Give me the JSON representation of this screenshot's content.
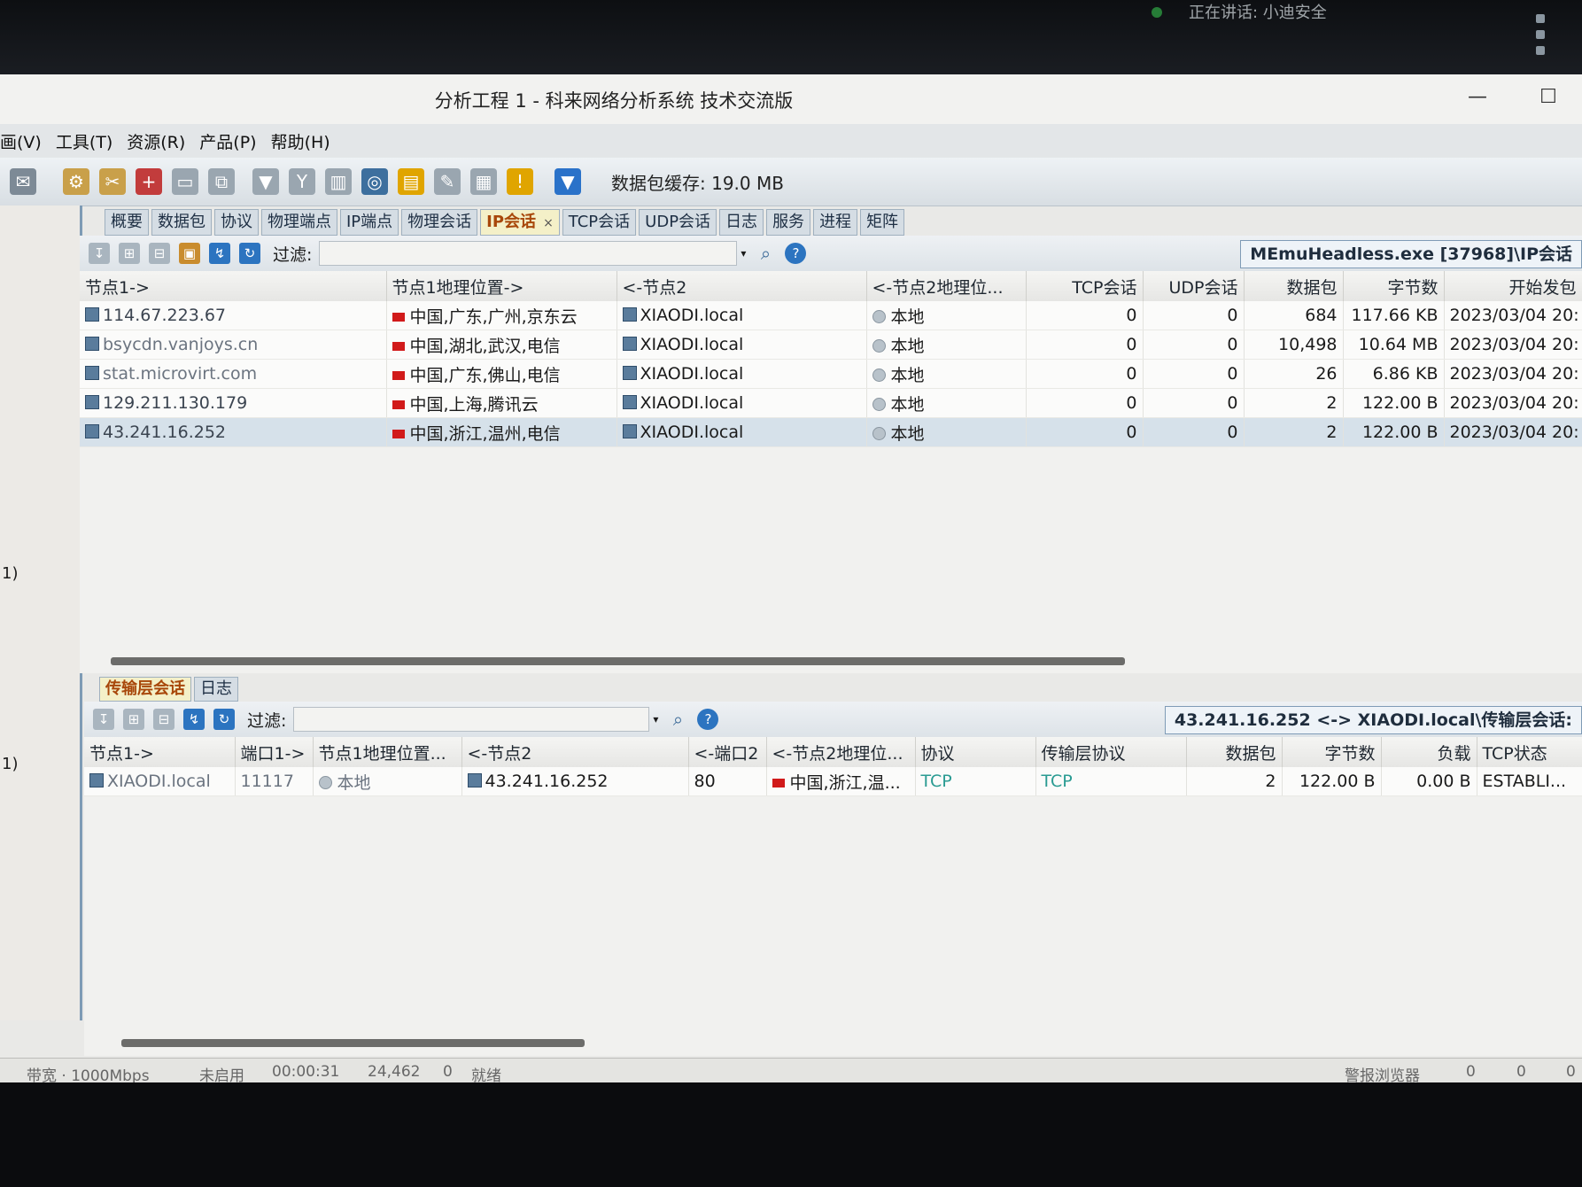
{
  "meeting": {
    "text": "正在讲话: 小迪安全"
  },
  "window": {
    "title": "分析工程 1 - 科来网络分析系统 技术交流版"
  },
  "menu": [
    "画(V)",
    "工具(T)",
    "资源(R)",
    "产品(P)",
    "帮助(H)"
  ],
  "toolbar": {
    "buffer": "数据包缓存: 19.0 MB"
  },
  "left_labels": [
    "1)",
    "1)"
  ],
  "tabs": [
    {
      "label": "概要"
    },
    {
      "label": "数据包"
    },
    {
      "label": "协议"
    },
    {
      "label": "物理端点"
    },
    {
      "label": "IP端点"
    },
    {
      "label": "物理会话"
    },
    {
      "label": "IP会话",
      "close": "×"
    },
    {
      "label": "TCP会话"
    },
    {
      "label": "UDP会话"
    },
    {
      "label": "日志"
    },
    {
      "label": "服务"
    },
    {
      "label": "进程"
    },
    {
      "label": "矩阵"
    }
  ],
  "upper": {
    "filter_label": "过滤:",
    "view_label": "MEmuHeadless.exe [37968]\\IP会话",
    "columns": [
      "节点1->",
      "节点1地理位置->",
      "<-节点2",
      "<-节点2地理位...",
      "TCP会话",
      "UDP会话",
      "数据包",
      "字节数",
      "开始发包"
    ],
    "rows": [
      {
        "node1": "114.67.223.67",
        "geo1": "中国,广东,广州,京东云",
        "node2": "XIAODI.local",
        "geo2": "本地",
        "tcp": "0",
        "udp": "0",
        "packets": "684",
        "bytes": "117.66 KB",
        "start": "2023/03/04 20:"
      },
      {
        "node1": "bsycdn.vanjoys.cn",
        "geo1": "中国,湖北,武汉,电信",
        "node2": "XIAODI.local",
        "geo2": "本地",
        "tcp": "0",
        "udp": "0",
        "packets": "10,498",
        "bytes": "10.64 MB",
        "start": "2023/03/04 20:"
      },
      {
        "node1": "stat.microvirt.com",
        "geo1": "中国,广东,佛山,电信",
        "node2": "XIAODI.local",
        "geo2": "本地",
        "tcp": "0",
        "udp": "0",
        "packets": "26",
        "bytes": "6.86 KB",
        "start": "2023/03/04 20:"
      },
      {
        "node1": "129.211.130.179",
        "geo1": "中国,上海,腾讯云",
        "node2": "XIAODI.local",
        "geo2": "本地",
        "tcp": "0",
        "udp": "0",
        "packets": "2",
        "bytes": "122.00 B",
        "start": "2023/03/04 20:"
      },
      {
        "node1": "43.241.16.252",
        "geo1": "中国,浙江,温州,电信",
        "node2": "XIAODI.local",
        "geo2": "本地",
        "tcp": "0",
        "udp": "0",
        "packets": "2",
        "bytes": "122.00 B",
        "start": "2023/03/04 20:"
      }
    ]
  },
  "lower_tabs": [
    "传输层会话",
    "日志"
  ],
  "lower": {
    "filter_label": "过滤:",
    "view_label": "43.241.16.252 <-> XIAODI.local\\传输层会话:",
    "columns": [
      "节点1->",
      "端口1->",
      "节点1地理位置...",
      "<-节点2",
      "<-端口2",
      "<-节点2地理位...",
      "协议",
      "传输层协议",
      "数据包",
      "字节数",
      "负载",
      "TCP状态"
    ],
    "row": {
      "node1": "XIAODI.local",
      "port1": "11117",
      "geo1": "本地",
      "node2": "43.241.16.252",
      "port2": "80",
      "geo2": "中国,浙江,温...",
      "proto": "TCP",
      "transport": "TCP",
      "packets": "2",
      "bytes": "122.00 B",
      "payload": "0.00 B",
      "state": "ESTABLI..."
    }
  },
  "status": {
    "bandwidth": "带宽 · 1000Mbps",
    "enabled": "未启用",
    "time": "00:00:31",
    "count1": "24,462",
    "count2": "0",
    "ready": "就绪",
    "alarm": "警报浏览器",
    "c1": "0",
    "c2": "0",
    "c3": "0"
  }
}
